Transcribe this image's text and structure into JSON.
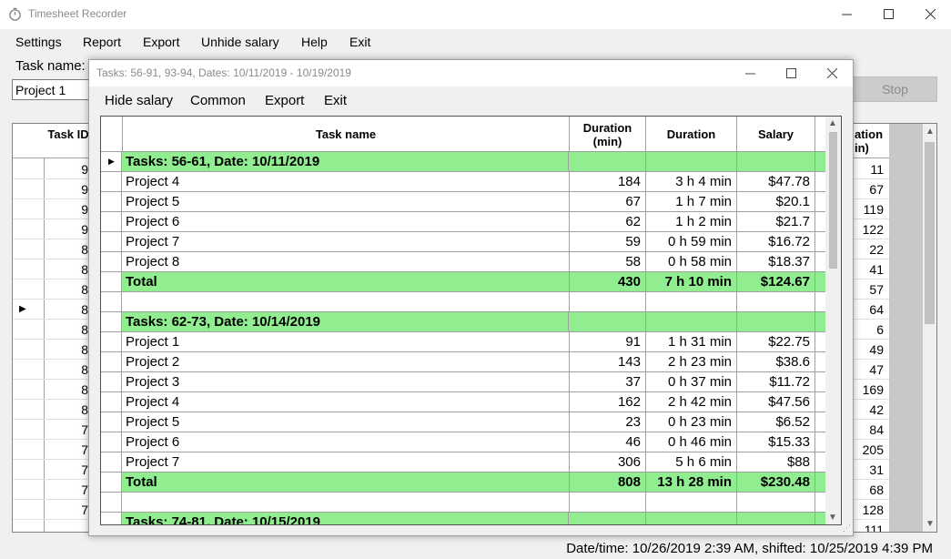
{
  "main_window": {
    "title": "Timesheet Recorder",
    "menu": [
      "Settings",
      "Report",
      "Export",
      "Unhide salary",
      "Help",
      "Exit"
    ],
    "task_name_label": "Task name:",
    "task_name_value": "Project 1",
    "stop_label": "Stop",
    "grid_headers": {
      "task_id": "Task ID",
      "duration": "ation in)"
    },
    "bg_ids": [
      "9",
      "9",
      "9",
      "9",
      "8",
      "8",
      "8",
      "8",
      "8",
      "8",
      "8",
      "8",
      "8",
      "7",
      "7",
      "7",
      "7",
      "7"
    ],
    "bg_durations": [
      "11",
      "67",
      "119",
      "122",
      "22",
      "41",
      "57",
      "64",
      "6",
      "49",
      "47",
      "169",
      "42",
      "84",
      "205",
      "31",
      "68",
      "128",
      "111"
    ],
    "status": "Date/time: 10/26/2019 2:39 AM, shifted: 10/25/2019 4:39 PM"
  },
  "dialog": {
    "title": "Tasks: 56-91, 93-94, Dates: 10/11/2019 - 10/19/2019",
    "menu": [
      "Hide salary",
      "Common",
      "Export",
      "Exit"
    ],
    "columns": [
      "Task name",
      "Duration (min)",
      "Duration",
      "Salary"
    ],
    "groups": [
      {
        "title": "Tasks: 56-61, Date: 10/11/2019",
        "rows": [
          [
            "Project 4",
            "184",
            "3 h 4 min",
            "$47.78"
          ],
          [
            "Project 5",
            "67",
            "1 h 7 min",
            "$20.1"
          ],
          [
            "Project 6",
            "62",
            "1 h 2 min",
            "$21.7"
          ],
          [
            "Project 7",
            "59",
            "0 h 59 min",
            "$16.72"
          ],
          [
            "Project 8",
            "58",
            "0 h 58 min",
            "$18.37"
          ]
        ],
        "total": [
          "Total",
          "430",
          "7 h 10 min",
          "$124.67"
        ]
      },
      {
        "title": "Tasks: 62-73, Date: 10/14/2019",
        "rows": [
          [
            "Project 1",
            "91",
            "1 h 31 min",
            "$22.75"
          ],
          [
            "Project 2",
            "143",
            "2 h 23 min",
            "$38.6"
          ],
          [
            "Project 3",
            "37",
            "0 h 37 min",
            "$11.72"
          ],
          [
            "Project 4",
            "162",
            "2 h 42 min",
            "$47.56"
          ],
          [
            "Project 5",
            "23",
            "0 h 23 min",
            "$6.52"
          ],
          [
            "Project 6",
            "46",
            "0 h 46 min",
            "$15.33"
          ],
          [
            "Project 7",
            "306",
            "5 h 6 min",
            "$88"
          ]
        ],
        "total": [
          "Total",
          "808",
          "13 h 28 min",
          "$230.48"
        ]
      },
      {
        "title": "Tasks: 74-81, Date: 10/15/2019",
        "rows": [],
        "total": null
      }
    ],
    "colors": {
      "group_bg": "#90ee90"
    }
  }
}
